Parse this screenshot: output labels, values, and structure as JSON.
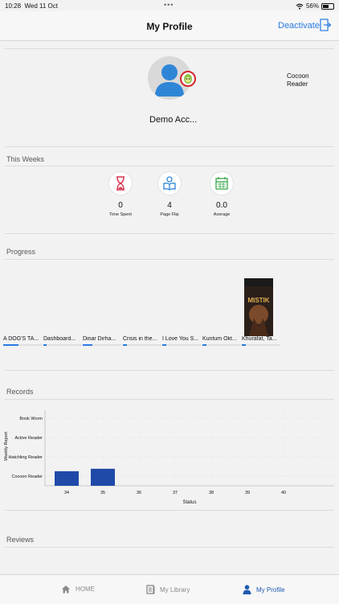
{
  "status_bar": {
    "time": "10:28",
    "date": "Wed 11 Oct",
    "battery": "56%"
  },
  "header": {
    "title": "My Profile",
    "deactivate_label": "Deactivate",
    "logout_icon": "logout-icon"
  },
  "profile": {
    "name": "Demo Acc...",
    "reader_level": "Cocoon Reader",
    "avatar_icon": "user-avatar-icon",
    "badge_icon": "avocado-badge-icon"
  },
  "this_weeks": {
    "title": "This Weeks",
    "stats": [
      {
        "value": "0",
        "label": "Time Spent",
        "icon": "hourglass-icon"
      },
      {
        "value": "4",
        "label": "Page Flip",
        "icon": "reading-icon"
      },
      {
        "value": "0.0",
        "label": "Average",
        "icon": "calendar-icon"
      }
    ]
  },
  "progress": {
    "title": "Progress",
    "books": [
      {
        "title": "A DOG'S TA...",
        "progress": 0.4
      },
      {
        "title": "Dashboard...",
        "progress": 0.08
      },
      {
        "title": "Dinar Dirha...",
        "progress": 0.25
      },
      {
        "title": "Crisis in the...",
        "progress": 0.1
      },
      {
        "title": "I Love You S...",
        "progress": 0.1
      },
      {
        "title": "Kuntum Okt...",
        "progress": 0.1
      },
      {
        "title": "Khurafat, Ta...",
        "progress": 0.1,
        "cover_text": "MISTIK"
      }
    ]
  },
  "records": {
    "title": "Records",
    "chart_data": {
      "type": "bar",
      "ylabel": "Weekly Report",
      "xlabel": "Status",
      "y_categories": [
        "Cocoon Reader",
        "Hatchling Reader",
        "Active Reader",
        "Book Worm"
      ],
      "x_ticks": [
        "34",
        "35",
        "36",
        "37",
        "38",
        "39",
        "40"
      ],
      "bars": [
        {
          "x": 34,
          "y": 0.4
        },
        {
          "x": 35,
          "y": 0.6
        }
      ],
      "bar_color": "#1f4aa8"
    }
  },
  "reviews": {
    "title": "Reviews"
  },
  "tab_bar": {
    "items": [
      {
        "label": "HOME",
        "icon": "home-icon"
      },
      {
        "label": "My Library",
        "icon": "library-icon"
      },
      {
        "label": "My Profile",
        "icon": "profile-icon"
      }
    ]
  }
}
